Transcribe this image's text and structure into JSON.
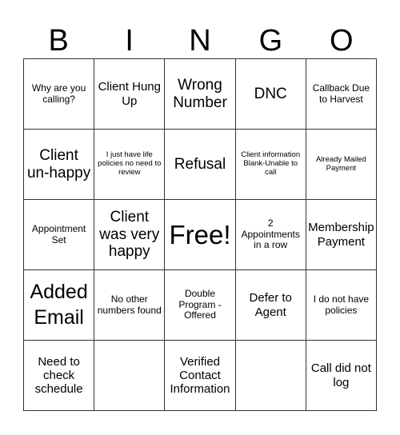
{
  "header": [
    "B",
    "I",
    "N",
    "G",
    "O"
  ],
  "cells": [
    "Why are you calling?",
    "Client Hung Up",
    "Wrong Number",
    "DNC",
    "Callback Due to Harvest",
    "Client un-happy",
    "I just have life policies no need to review",
    "Refusal",
    "Client information Blank-Unable to call",
    "Already Mailed Payment",
    "Appointment Set",
    "Client was very happy",
    "Free!",
    "2 Appointments in a row",
    "Membership Payment",
    "Added Email",
    "No other numbers found",
    "Double Program - Offered",
    "Defer to Agent",
    "I do not have policies",
    "Need to check schedule",
    "",
    "Verified Contact Information",
    "",
    "Call did not log"
  ]
}
